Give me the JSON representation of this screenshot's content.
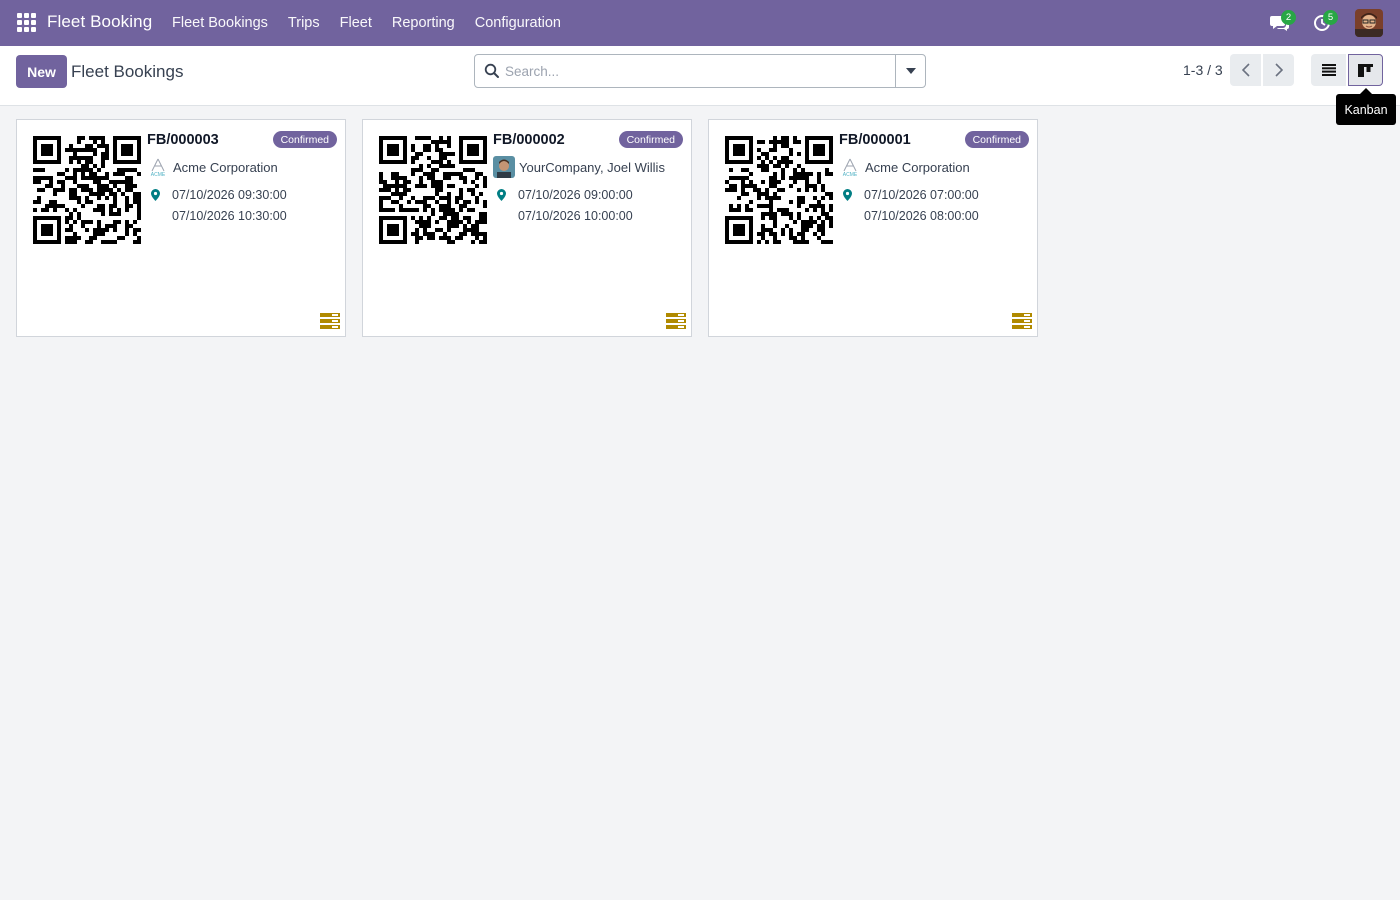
{
  "app": {
    "title": "Fleet Booking"
  },
  "nav": {
    "items": [
      {
        "label": "Fleet Bookings"
      },
      {
        "label": "Trips"
      },
      {
        "label": "Fleet"
      },
      {
        "label": "Reporting"
      },
      {
        "label": "Configuration"
      }
    ]
  },
  "systray": {
    "messages_count": "2",
    "activities_count": "5"
  },
  "control": {
    "new_label": "New",
    "breadcrumb": "Fleet Bookings",
    "search_placeholder": "Search...",
    "pager": "1-3 / 3",
    "tooltip": "Kanban"
  },
  "cards": [
    {
      "ref": "FB/000003",
      "status": "Confirmed",
      "partner": "Acme Corporation",
      "partner_logo": "acme-logo",
      "start": "07/10/2026 09:30:00",
      "end": "07/10/2026 10:30:00"
    },
    {
      "ref": "FB/000002",
      "status": "Confirmed",
      "partner": "YourCompany, Joel Willis",
      "partner_logo": "person-avatar",
      "start": "07/10/2026 09:00:00",
      "end": "07/10/2026 10:00:00"
    },
    {
      "ref": "FB/000001",
      "status": "Confirmed",
      "partner": "Acme Corporation",
      "partner_logo": "acme-logo",
      "start": "07/10/2026 07:00:00",
      "end": "07/10/2026 08:00:00"
    }
  ],
  "colors": {
    "brand": "#71639e",
    "badge": "#28a745",
    "pin": "#017e84",
    "stack": "#b08a00"
  }
}
